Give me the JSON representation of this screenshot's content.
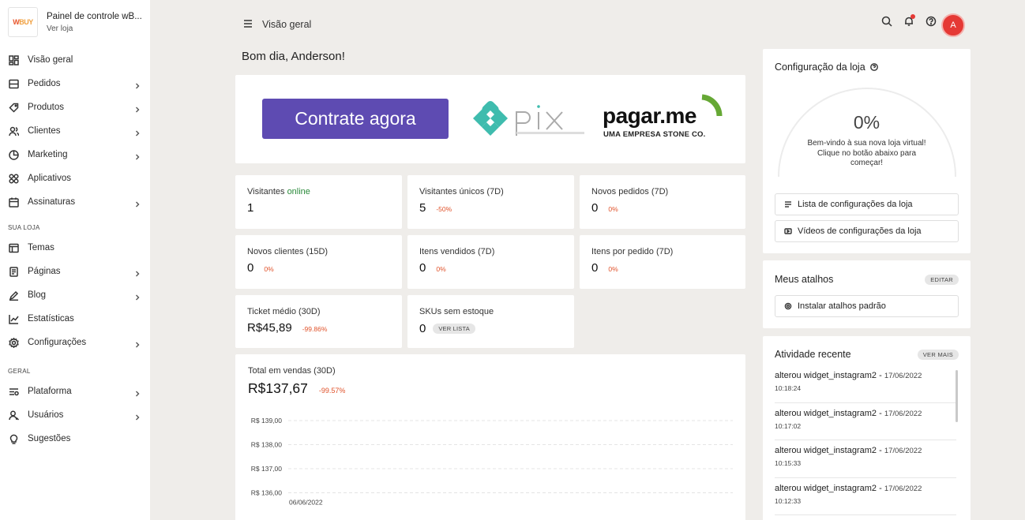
{
  "store": {
    "logo_text_1": "W",
    "logo_text_2": "BUY",
    "name": "Painel de controle wB...",
    "view_store": "Ver loja"
  },
  "nav": {
    "main": [
      {
        "label": "Visão geral",
        "icon": "dashboard-icon",
        "chevron": false
      },
      {
        "label": "Pedidos",
        "icon": "orders-icon",
        "chevron": true
      },
      {
        "label": "Produtos",
        "icon": "tag-icon",
        "chevron": true
      },
      {
        "label": "Clientes",
        "icon": "users-icon",
        "chevron": true
      },
      {
        "label": "Marketing",
        "icon": "pie-chart-icon",
        "chevron": true
      },
      {
        "label": "Aplicativos",
        "icon": "apps-icon",
        "chevron": false
      },
      {
        "label": "Assinaturas",
        "icon": "calendar-icon",
        "chevron": true
      }
    ],
    "section_store": "SUA LOJA",
    "store": [
      {
        "label": "Temas",
        "icon": "layout-icon",
        "chevron": false
      },
      {
        "label": "Páginas",
        "icon": "page-icon",
        "chevron": true
      },
      {
        "label": "Blog",
        "icon": "pen-icon",
        "chevron": true
      },
      {
        "label": "Estatísticas",
        "icon": "stats-icon",
        "chevron": false
      },
      {
        "label": "Configurações",
        "icon": "gear-icon",
        "chevron": true
      }
    ],
    "section_general": "GERAL",
    "general": [
      {
        "label": "Plataforma",
        "icon": "platform-icon",
        "chevron": true
      },
      {
        "label": "Usuários",
        "icon": "user-icon",
        "chevron": true
      },
      {
        "label": "Sugestões",
        "icon": "bulb-icon",
        "chevron": false
      }
    ]
  },
  "header": {
    "title": "Visão geral",
    "avatar_initial": "A"
  },
  "greeting": "Bom dia, Anderson!",
  "banner": {
    "cta": "Contrate agora",
    "pagarme_name": "pagar.me",
    "pagarme_sub": "UMA EMPRESA STONE CO."
  },
  "stats": [
    {
      "label": "Visitantes ",
      "label_highlight": "online",
      "value": "1",
      "delta": ""
    },
    {
      "label": "Visitantes únicos (7D)",
      "value": "5",
      "delta": "-50%"
    },
    {
      "label": "Novos pedidos (7D)",
      "value": "0",
      "delta": "0%"
    },
    {
      "label": "Novos clientes (15D)",
      "value": "0",
      "delta": "0%"
    },
    {
      "label": "Itens vendidos (7D)",
      "value": "0",
      "delta": "0%"
    },
    {
      "label": "Itens por pedido (7D)",
      "value": "0",
      "delta": "0%"
    },
    {
      "label": "Ticket médio (30D)",
      "value": "R$45,89",
      "delta": "-99.86%"
    },
    {
      "label": "SKUs sem estoque",
      "value": "0",
      "pill": "VER LISTA"
    }
  ],
  "sales": {
    "label": "Total em vendas (30D)",
    "value": "R$137,67",
    "delta": "-99.57%"
  },
  "chart_data": {
    "type": "line",
    "y_ticks": [
      "R$ 139,00",
      "R$ 138,00",
      "R$ 137,00",
      "R$ 136,00"
    ],
    "y_tick_values": [
      139,
      138,
      137,
      136
    ],
    "x_ticks": [
      "06/06/2022"
    ],
    "grid": true,
    "series": []
  },
  "config": {
    "title": "Configuração da loja",
    "percent": "0%",
    "progress": 0,
    "message": "Bem-vindo à sua nova loja virtual! Clique no botão abaixo para começar!",
    "btn_list": "Lista de configurações da loja",
    "btn_videos": "Vídeos de configurações da loja"
  },
  "shortcuts": {
    "title": "Meus atalhos",
    "edit": "EDITAR",
    "install": "Instalar atalhos padrão"
  },
  "activity": {
    "title": "Atividade recente",
    "see_more": "VER MAIS",
    "items": [
      {
        "text": "alterou widget_instagram2",
        "date": "17/06/2022",
        "time": "10:18:24"
      },
      {
        "text": "alterou widget_instagram2",
        "date": "17/06/2022",
        "time": "10:17:02"
      },
      {
        "text": "alterou widget_instagram2",
        "date": "17/06/2022",
        "time": "10:15:33"
      },
      {
        "text": "alterou widget_instagram2",
        "date": "17/06/2022",
        "time": "10:12:33"
      }
    ]
  }
}
